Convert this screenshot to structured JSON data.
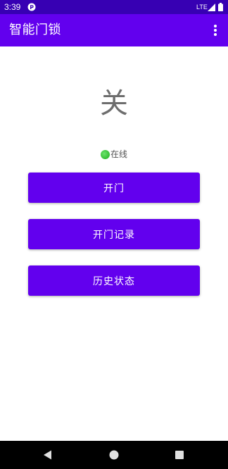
{
  "status_bar": {
    "time": "3:39",
    "network": "LTE",
    "icons": [
      "app-notification-icon",
      "signal-icon",
      "battery-icon"
    ]
  },
  "app_bar": {
    "title": "智能门锁",
    "menu_icon": "more-vert-icon"
  },
  "lock": {
    "state": "关"
  },
  "connection": {
    "status_label": "在线",
    "status_color": "#3cc43c"
  },
  "buttons": {
    "open": "开门",
    "records": "开门记录",
    "history": "历史状态"
  },
  "nav_bar": {
    "icons": [
      "back-icon",
      "home-icon",
      "recents-icon"
    ]
  },
  "colors": {
    "primary": "#6200ee",
    "primary_dark": "#3700b3",
    "text_secondary": "#6d6d6d"
  }
}
